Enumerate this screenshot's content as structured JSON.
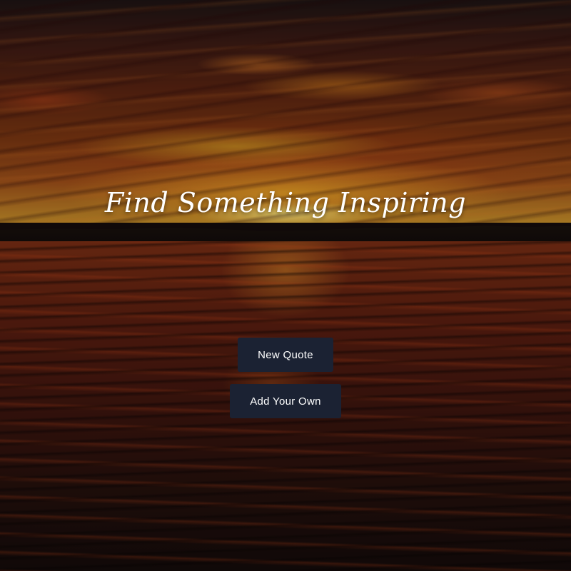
{
  "hero": {
    "title": "Find Something Inspiring"
  },
  "actions": {
    "new_quote_label": "New Quote",
    "add_own_label": "Add Your Own"
  },
  "colors": {
    "button_bg": "#1b2233",
    "button_text": "#ffffff",
    "title_text": "#ffffff"
  }
}
